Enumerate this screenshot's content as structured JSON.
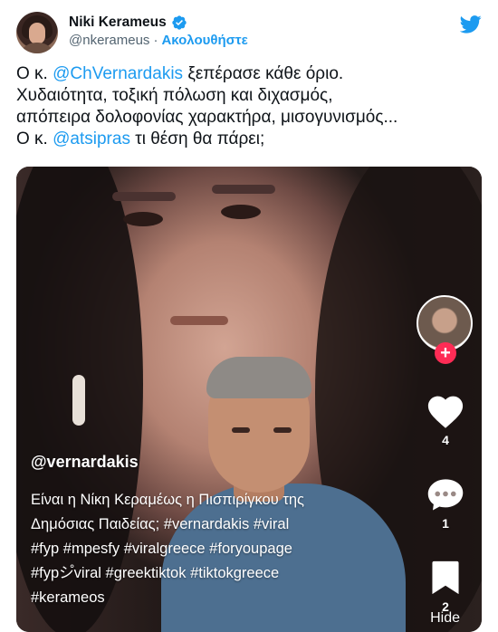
{
  "author": {
    "display_name": "Niki Kerameus",
    "handle": "@nkerameus",
    "separator": "·",
    "follow_label": "Ακολουθήστε"
  },
  "tweet": {
    "line1": {
      "prefix": "Ο κ. ",
      "mention": "@ChVernardakis",
      "suffix": " ξεπέρασε κάθε όριο."
    },
    "line2": "Χυδαιότητα, τοξική πόλωση και διχασμός,",
    "line3": "απόπειρα δολοφονίας χαρακτήρα, μισογυνισμός...",
    "line4": {
      "prefix": "Ο κ. ",
      "mention": "@atsipras",
      "suffix": " τι θέση θα πάρει;"
    }
  },
  "video": {
    "username": "@vernardakis",
    "caption_lines": [
      "Είναι η Νίκη Κεραμέως η Πισπιρίγκου της",
      "Δημόσιας Παιδείας; #vernardakis #viral",
      "#fyp #mpesfy #viralgreece #foryoupage",
      "#fypシ゚viral #greektiktok #tiktokgreece",
      "#kerameos"
    ],
    "likes": "4",
    "comments": "1",
    "saves": "2",
    "follow_plus": "+",
    "hide_label": "Hide"
  },
  "colors": {
    "accent": "#1d9bf0",
    "tiktok_plus": "#fe2c55"
  },
  "icons": {
    "verified": "verified-badge-icon",
    "brand": "twitter-bird-icon",
    "like": "heart-icon",
    "comment": "comment-bubble-icon",
    "save": "bookmark-icon"
  }
}
